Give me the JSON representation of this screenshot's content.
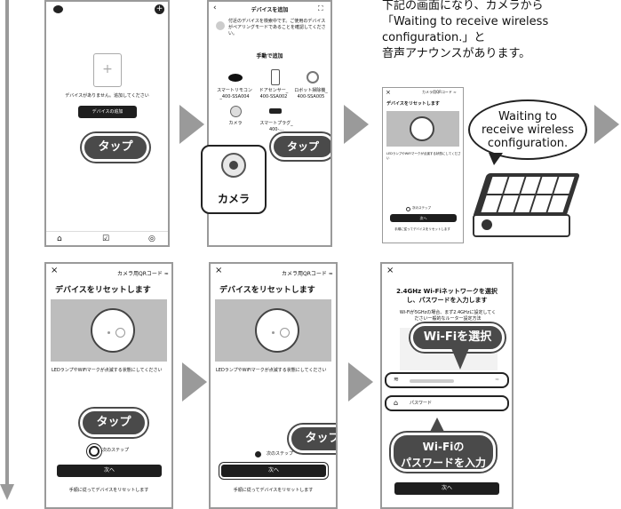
{
  "s1": {
    "empty_text": "デバイスがありません。追加してください",
    "add_btn": "デバイスの追加",
    "tap": "タップ"
  },
  "s2": {
    "title": "デバイスを追加",
    "desc": "付近のデバイスを検索中です。ご使用のデバイスがペアリングモードであることを確認してください。",
    "manual": "手動で追加",
    "devices": [
      {
        "label": "スマートリモコン _400-SSA004"
      },
      {
        "label": "ドアセンサー_ 400-SSA002"
      },
      {
        "label": "ロボット掃除機_ 400-SSA005"
      },
      {
        "label": "カメラ"
      },
      {
        "label": "スマートプラグ_ 400-..."
      }
    ],
    "tap": "タップ",
    "camera": "カメラ"
  },
  "top_text": {
    "l1": "下記の画面になり、カメラから",
    "l2": "「Waiting to receive wireless",
    "l3": "configuration.」と",
    "l4": "音声アナウンスがあります。"
  },
  "s3": {
    "header": "カメラ用QRコード ≈",
    "title": "デバイスをリセットします",
    "desc": "LEDランプやWiFiマークが点滅する状態にしてください",
    "step": "次のステップ",
    "next": "次へ",
    "link": "手順に従ってデバイスをリセットします"
  },
  "bubble": {
    "l1": "Waiting to",
    "l2": "receive wireless",
    "l3": "configuration."
  },
  "s4": {
    "close": "×",
    "header": "カメラ用QRコード ≈",
    "title": "デバイスをリセットします",
    "desc": "LEDランプやWiFiマークが点滅する状態にしてください",
    "tap": "タップ",
    "step": "次のステップ",
    "next": "次へ",
    "link": "手順に従ってデバイスをリセットします"
  },
  "s5": {
    "close": "×",
    "header": "カメラ用QRコード ≈",
    "title": "デバイスをリセットします",
    "desc": "LEDランプやWiFiマークが点滅する状態にしてください",
    "tap": "タップ",
    "step": "次のステップ",
    "next": "次へ",
    "link": "手順に従ってデバイスをリセットします"
  },
  "s6": {
    "close": "×",
    "title1": "2.4GHz Wi-Fiネットワークを選択",
    "title2": "し、パスワードを入力します",
    "desc": "Wi-Fiが5GHzの場合、まず2.4GHzに設定してください一般的なルーター設定方法",
    "wifi_select": "Wi-Fiを選択",
    "password": "パスワード",
    "wifi_pass1": "Wi-Fiの",
    "wifi_pass2": "パスワードを入力",
    "next": "次へ"
  }
}
